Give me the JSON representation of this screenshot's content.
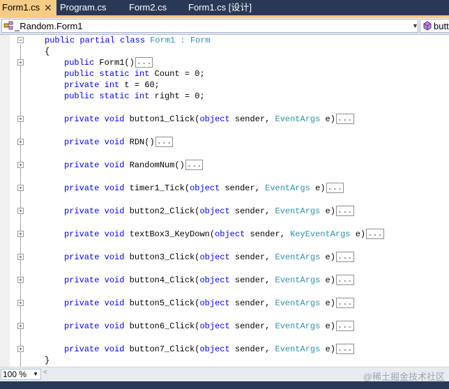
{
  "tabs": [
    {
      "label": "Form1.cs",
      "active": true,
      "close_glyph": "✕"
    },
    {
      "label": "Program.cs",
      "active": false
    },
    {
      "label": "Form2.cs",
      "active": false
    },
    {
      "label": "Form1.cs [设计]",
      "active": false
    }
  ],
  "navbar": {
    "type_combo": "_Random.Form1",
    "member_combo": "butt",
    "type_icon": "class-icon",
    "member_icon": "method-icon"
  },
  "editor": {
    "class_decl": {
      "prefix": "public partial class ",
      "name": "Form1",
      "sep": " : ",
      "base": "Form"
    },
    "open_brace": "{",
    "close_brace": "}",
    "constructor": {
      "text": "public Form1()",
      "ellipsis": "..."
    },
    "fields": [
      {
        "kw1": "public",
        "kw2": "static",
        "type": "int",
        "rest": " Count = 0;"
      },
      {
        "kw1": "private",
        "kw2": "",
        "type": "int",
        "rest": " t = 60;"
      },
      {
        "kw1": "public",
        "kw2": "static",
        "type": "int",
        "rest": " right = 0;"
      }
    ],
    "methods": [
      {
        "name": "button1_Click",
        "args": true,
        "argtype": "EventArgs",
        "ellipsis": "..."
      },
      {
        "name": "RDN",
        "args": false,
        "ellipsis": "..."
      },
      {
        "name": "RandomNum",
        "args": false,
        "ellipsis": "..."
      },
      {
        "name": "timer1_Tick",
        "args": true,
        "argtype": "EventArgs",
        "ellipsis": "..."
      },
      {
        "name": "button2_Click",
        "args": true,
        "argtype": "EventArgs",
        "ellipsis": "..."
      },
      {
        "name": "textBox3_KeyDown",
        "args": true,
        "argtype": "KeyEventArgs",
        "ellipsis": "..."
      },
      {
        "name": "button3_Click",
        "args": true,
        "argtype": "EventArgs",
        "ellipsis": "..."
      },
      {
        "name": "button4_Click",
        "args": true,
        "argtype": "EventArgs",
        "ellipsis": "..."
      },
      {
        "name": "button5_Click",
        "args": true,
        "argtype": "EventArgs",
        "ellipsis": "..."
      },
      {
        "name": "button6_Click",
        "args": true,
        "argtype": "EventArgs",
        "ellipsis": "..."
      },
      {
        "name": "button7_Click",
        "args": true,
        "argtype": "EventArgs",
        "ellipsis": "..."
      }
    ],
    "colors": {
      "keyword": "#0000ff",
      "type": "#2b91af",
      "text": "#000000"
    }
  },
  "statusbar": {
    "zoom": "100 %",
    "scroll_left_glyph": "<"
  },
  "watermark": "@稀土掘金技术社区",
  "colors": {
    "tab_strip": "#293955",
    "active_tab": "#f5cc84"
  }
}
